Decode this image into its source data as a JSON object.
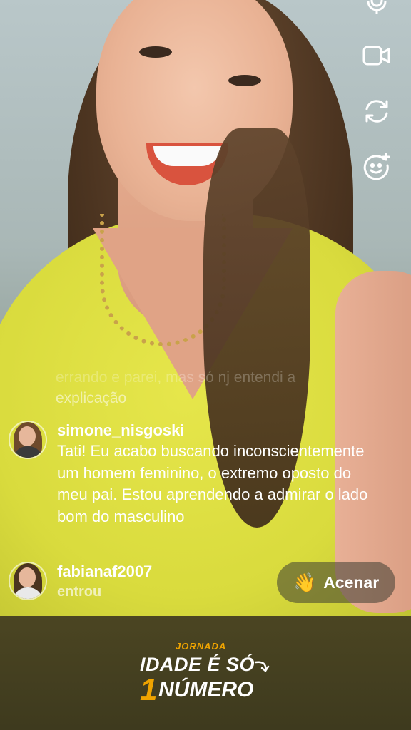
{
  "live": {
    "controls": [
      {
        "name": "microphone-icon"
      },
      {
        "name": "video-camera-icon"
      },
      {
        "name": "flip-camera-icon"
      },
      {
        "name": "face-effects-icon"
      }
    ],
    "faded_comment": {
      "line1": "errando e parei, mas só nj entendi a",
      "line2": "explicação"
    },
    "comments": [
      {
        "user": "simone_nisgoski",
        "text": "Tati! Eu acabo buscando inconscientemente um homem feminino, o extremo oposto do meu pai. Estou aprendendo a admirar o lado bom do masculino"
      },
      {
        "user": "fabianaf2007",
        "status": "entrou"
      }
    ],
    "wave_button": {
      "emoji": "👋",
      "label": "Acenar"
    }
  },
  "banner": {
    "small": "JORNADA",
    "line1": "IDADE É SÓ",
    "number": "1",
    "line2": "NÚMERO",
    "accent_color": "#f0a400"
  }
}
